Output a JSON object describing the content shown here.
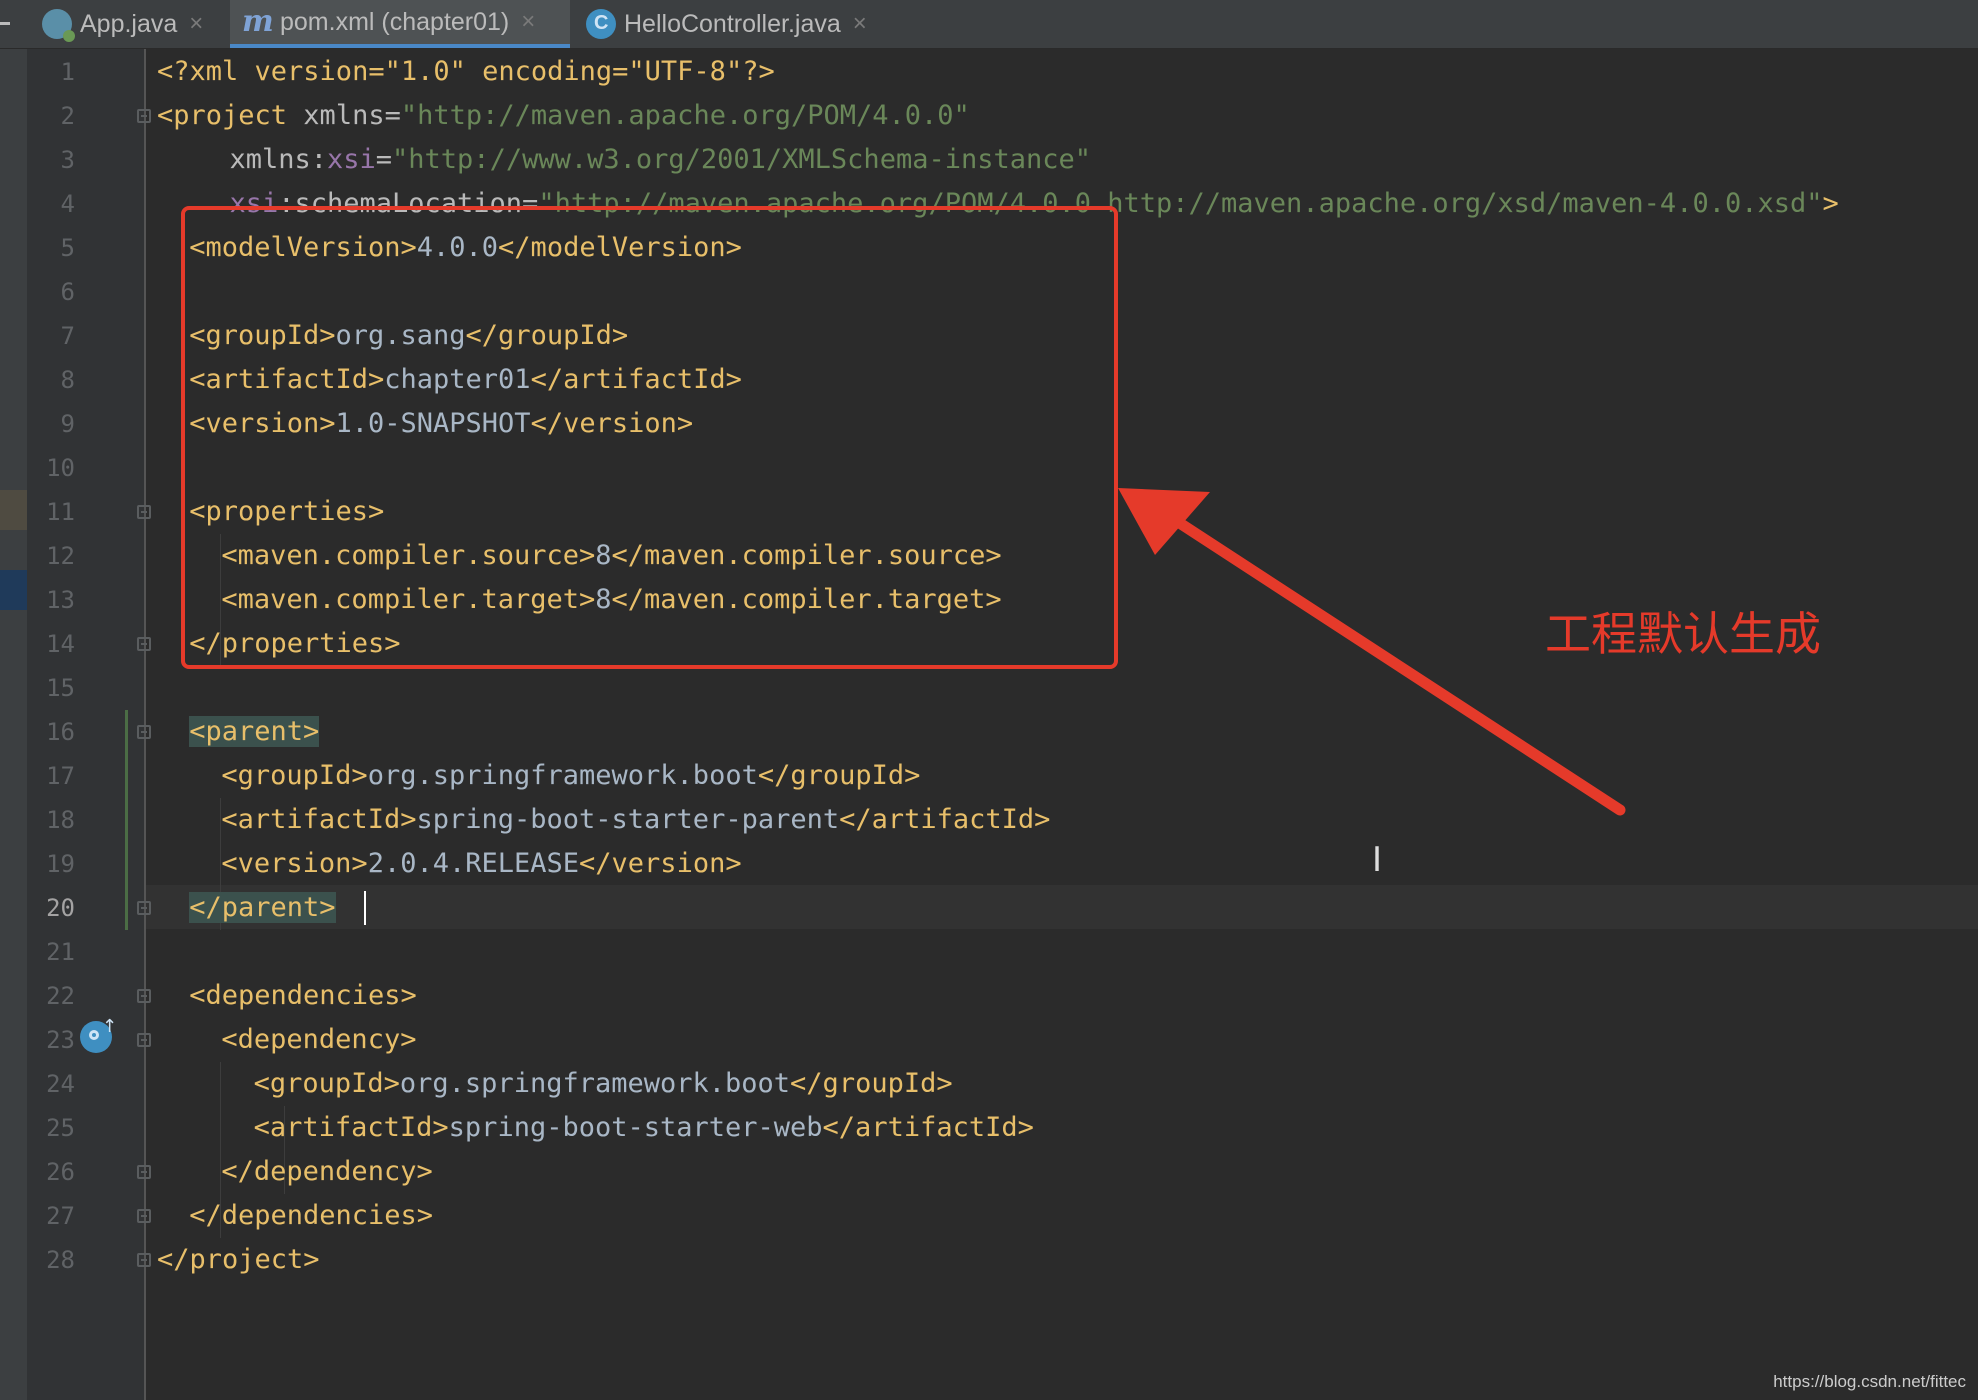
{
  "tabs": [
    {
      "label": "App.java",
      "icon": "spring-app-icon",
      "active": false
    },
    {
      "label": "pom.xml (chapter01)",
      "icon": "maven-icon",
      "active": true
    },
    {
      "label": "HelloController.java",
      "icon": "java-class-icon",
      "active": false
    }
  ],
  "tab_close_glyph": "×",
  "maven_glyph": "m",
  "editor": {
    "current_line": 20,
    "line_numbers": [
      "1",
      "2",
      "3",
      "4",
      "5",
      "6",
      "7",
      "8",
      "9",
      "10",
      "11",
      "12",
      "13",
      "14",
      "15",
      "16",
      "17",
      "18",
      "19",
      "20",
      "21",
      "22",
      "23",
      "24",
      "25",
      "26",
      "27",
      "28"
    ],
    "lines": [
      [
        "<?xml version=\"1.0\" encoding=\"UTF-8\"?>"
      ],
      [
        "<project",
        " xmlns=",
        "\"http://maven.apache.org/POM/4.0.0\""
      ],
      [
        "xmlns:",
        "xsi",
        "=",
        "\"http://www.w3.org/2001/XMLSchema-instance\""
      ],
      [
        "xsi",
        ":schemaLocation=",
        "\"http://maven.apache.org/POM/4.0.0 http://maven.apache.org/xsd/maven-4.0.0.xsd\"",
        ">"
      ],
      [
        "<modelVersion>",
        "4.0.0",
        "</modelVersion>"
      ],
      [],
      [
        "<groupId>",
        "org.sang",
        "</groupId>"
      ],
      [
        "<artifactId>",
        "chapter01",
        "</artifactId>"
      ],
      [
        "<version>",
        "1.0-SNAPSHOT",
        "</version>"
      ],
      [],
      [
        "<properties>"
      ],
      [
        "<maven.compiler.source>",
        "8",
        "</maven.compiler.source>"
      ],
      [
        "<maven.compiler.target>",
        "8",
        "</maven.compiler.target>"
      ],
      [
        "</properties>"
      ],
      [],
      [
        "<parent>"
      ],
      [
        "<groupId>",
        "org.springframework.boot",
        "</groupId>"
      ],
      [
        "<artifactId>",
        "spring-boot-starter-parent",
        "</artifactId>"
      ],
      [
        "<version>",
        "2.0.4.RELEASE",
        "</version>"
      ],
      [
        "</parent>"
      ],
      [],
      [
        "<dependencies>"
      ],
      [
        "<dependency>"
      ],
      [
        "<groupId>",
        "org.springframework.boot",
        "</groupId>"
      ],
      [
        "<artifactId>",
        "spring-boot-starter-web",
        "</artifactId>"
      ],
      [
        "</dependency>"
      ],
      [
        "</dependencies>"
      ],
      [
        "</project>"
      ]
    ]
  },
  "annotation": {
    "label": "工程默认生成",
    "color": "#e53a2a"
  },
  "cursor_glyph": "I",
  "watermark": "https://blog.csdn.net/fittec",
  "colors": {
    "background": "#2b2b2b",
    "tag": "#e8bf6a",
    "string": "#6a8759",
    "text": "#a9b7c6",
    "namespace": "#9876aa",
    "tab_accent": "#4a88c7"
  }
}
